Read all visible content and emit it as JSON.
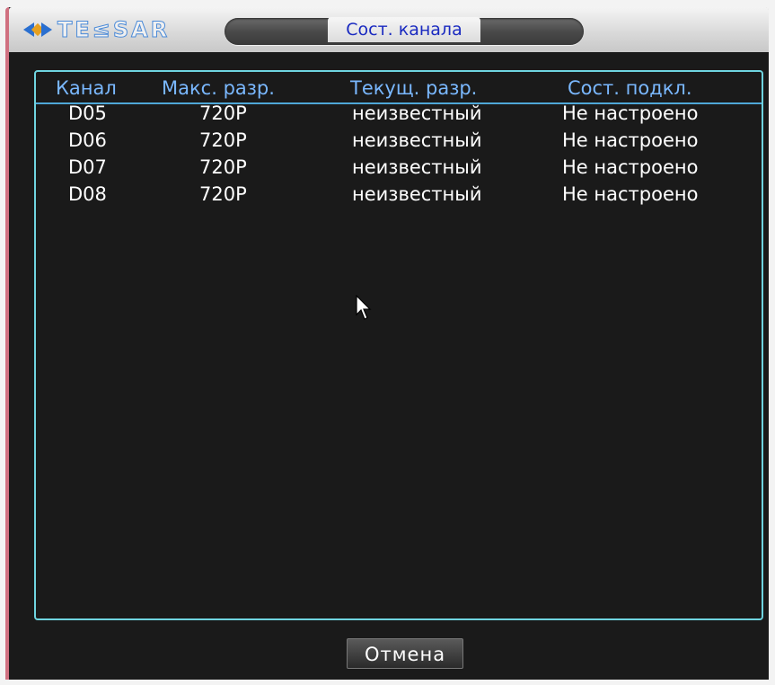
{
  "window": {
    "title": "Сост. канала",
    "brand": "TE≤SAR"
  },
  "table": {
    "columns": [
      "Канал",
      "Макс. разр.",
      "Текущ. разр.",
      "Сост. подкл."
    ],
    "rows": [
      {
        "channel": "D05",
        "max_res": "720P",
        "cur_res": "неизвестный",
        "status": "Не настроено"
      },
      {
        "channel": "D06",
        "max_res": "720P",
        "cur_res": "неизвестный",
        "status": "Не настроено"
      },
      {
        "channel": "D07",
        "max_res": "720P",
        "cur_res": "неизвестный",
        "status": "Не настроено"
      },
      {
        "channel": "D08",
        "max_res": "720P",
        "cur_res": "неизвестный",
        "status": "Не настроено"
      }
    ]
  },
  "buttons": {
    "cancel_label": "Отмена"
  },
  "colors": {
    "panel_border": "#6fd4e0",
    "header_text": "#7ab8ff",
    "title_text": "#1a2ac0"
  }
}
